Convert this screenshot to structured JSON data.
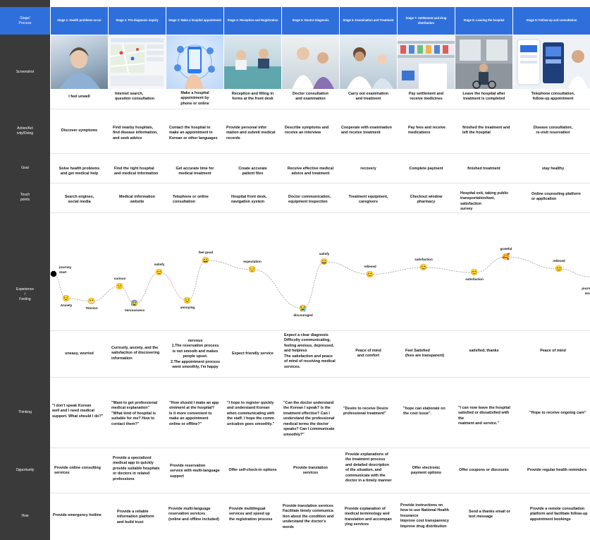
{
  "row_labels": {
    "stage": "Stage/\nProcess",
    "screenshot": "Screenshot",
    "action": "Action/Act\nivity/Doing",
    "goal": "Goal",
    "touch": "Touch\npoints",
    "experience": "Experience\n/\nFeeling",
    "thinking": "Thinking",
    "opportunity": "Opportunity",
    "how": "How"
  },
  "stages": [
    "Stage 1: Health problems occur",
    "Stage 2: Pre-diagnosis inquiry",
    "Stage 3: Make a hospital appointment",
    "Stage 4: Reception and Registration",
    "Stage 5: Doctor Diagnosis",
    "Stage 6: Examination and Treatment",
    "Stage 7: Settlement and drug distribution",
    "Stage 8: Leaving the hospital",
    "Stage 9: Follow-up and consultation"
  ],
  "captions": [
    "I feel unwell",
    "Internet search,\nquestion consultation",
    "Make a hospital\nappointment by\nphone or online",
    "Reception and filling in\nforms at the front desk",
    "Doctor consultation\nand examination",
    "Carry out examination\nand treatment",
    "Pay settlement and\nreceive medicines",
    "Leave the hospital after\ntreatment is completed",
    "Telephone consultation,\nfollow-up appointment"
  ],
  "actions": [
    "Discover symptoms",
    "Find nearby hospitals,\nfind disease information,\nand seek advice",
    "Contact the hospital to\nmake an appointment in\nKorean or other languages",
    "Provide personal infor\nmation and submit medical\nrecords",
    "Describe symptoms and\nreceive an interview",
    "Cooperate with examination\nand receive treatment",
    "Pay fees and receive\nmedications",
    "finished the treatment and\nleft the hospital",
    "Disease consultation,\nre-visit reservation"
  ],
  "goals": [
    "Solve health problems\nand get medical help",
    "Find the right hospital\nand medical information",
    "Get accurate time for\nmedical treatment",
    "Create accurate\npatient files",
    "Receive effective medical\nadvice and treatment",
    "recovery",
    "Complete payment",
    "finished treatment",
    "stay healthy"
  ],
  "touchpoints": [
    "Search engines,\nsocial media",
    "Medical information\nwebsite",
    "Telephone or online\nconsultation",
    "Hospital front desk,\nnavigation system",
    "Doctor communication,\nequipment inspection",
    "Treatment equipment,\ncaregivers",
    "Checkout window\npharmacy",
    "Hospital exit, taking public\ntransportation/taxi, satisfaction\nsurvey",
    "Online counseling platform\nor application"
  ],
  "experience": {
    "start_label": "journey\nstart",
    "end_label": "journey\nend",
    "points": [
      {
        "label": "Anxiety",
        "emoji": "😟",
        "level": 0.17
      },
      {
        "label": "Tension",
        "emoji": "😬",
        "level": 0.12
      },
      {
        "label": "curious",
        "emoji": "😕",
        "level": 0.37
      },
      {
        "label": "nervousness",
        "emoji": "😰",
        "level": 0.08
      },
      {
        "label": "satisfy",
        "emoji": "😊",
        "level": 0.6
      },
      {
        "label": "annoying",
        "emoji": "😟",
        "level": 0.13
      },
      {
        "label": "feel good",
        "emoji": "😄",
        "level": 0.8
      },
      {
        "label": "expectation",
        "emoji": "😌",
        "level": 0.65
      },
      {
        "label": "discouraged",
        "emoji": "😭",
        "level": 0.0
      },
      {
        "label": "satisfy",
        "emoji": "😄",
        "level": 0.78
      },
      {
        "label": "relieved",
        "emoji": "😊",
        "level": 0.57
      },
      {
        "label": "satisfaction",
        "emoji": "😊",
        "level": 0.68
      },
      {
        "label": "satisfaction",
        "emoji": "😊",
        "level": 0.6
      },
      {
        "label": "grateful",
        "emoji": "🥰",
        "level": 0.86
      },
      {
        "label": "relieved",
        "emoji": "😊",
        "level": 0.66
      }
    ]
  },
  "feelings": [
    "uneasy, worried",
    "Curiosity, anxiety, and the\nsatisfaction of discovering\ninformation",
    "nervous\n1.The reservation process\nis not smooth and makes\npeople upset.\n2.The appointment process\nwent smoothly, I'm happy",
    "Expect friendly service",
    "Expect a clear diagnosis\nDifficulty communicating,\nfeeling anxious, depressed,\nand helpless\nThe satisfaction and peace\nof mind of receiving medical\nservices.",
    "Peace of mind\nand comfort",
    "Feel Satisfied\n(fees are transparent)",
    "satisfied, thanks",
    "Peace of mind"
  ],
  "thinking": [
    "\"I don't speak Korean\nwell and I need medical\nsupport. What should I do?\"",
    "\"Want to get professional\nmedical explanation\"\n\"What kind of hospital is\nsuitable for me? How to\ncontact them?\"",
    "\"How should I make an app\nointment at the hospital?\nIs it more convenient to\nmake an appointment\nonline or offline?\"",
    "\"I hope to register quickly\nand understand Korean\nwhen communicating with\nthe staff. I hope the comm\nunication goes smoothly.\"",
    "\"Can the doctor understand\nthe Korean I speak? Is the\ntreatment effective? Can I\nunderstand the professional\nmedical terms the doctor\nspeaks? Can I communicate\nsmoothly?\"",
    "\"Desire to receive Desire\nprofessional treatment\"",
    "\"hope can elaborate on\nthe cost issue\".",
    "\"I can now leave the hospital\nsatisfied or dissatisfied with the\nreatment and service.\"",
    "\"Hope to receive ongoing care\""
  ],
  "opportunity": [
    "Provide online consulting\nservices",
    "Provide a specialized\nmedical app to quickly\nprovide suitable hospitals\nor doctors in related\nprofessions",
    "Provide reservation\nservice with multi-language\nsupport",
    "Offer self-check-in options",
    "Provide translation\nservices",
    "Provide explanations of\nthe treatment process\nand detailed description\nof the situation, and\ncommunicate with the\ndoctor in a timely manner",
    "Offer electronic\npayment options",
    "Offer coupons or discounts",
    "Provide regular health reminders"
  ],
  "how": [
    "Provide emergency hotline",
    "Provide a reliable\ninformation platform\nand build trust",
    "Provide multi-language\nreservation services\n(online and offline included)",
    "Provide multilingual\nservices and speed up\nthe registration process",
    "Provide translation services\nFacilitate timely communica\ntion about the condition and\nunderstand the doctor's\nwords",
    "Provide explanation of\nmedical terminology and\ntranslation and accompan\nying services",
    "Provide instructions on\nhow to use National Health\nInsurance\nImprove cost transparency\nImprove drug distribution",
    "Send a thanks email or\ntext message",
    "Provide a remote consultation\nplatform and facilitate follow-up\nappointment bookings"
  ],
  "colors": {
    "header_blue": "#2f6fdc",
    "label_dark": "#3a3a3a",
    "divider": "#e4e4e4",
    "curve": "#9a9a9a"
  }
}
